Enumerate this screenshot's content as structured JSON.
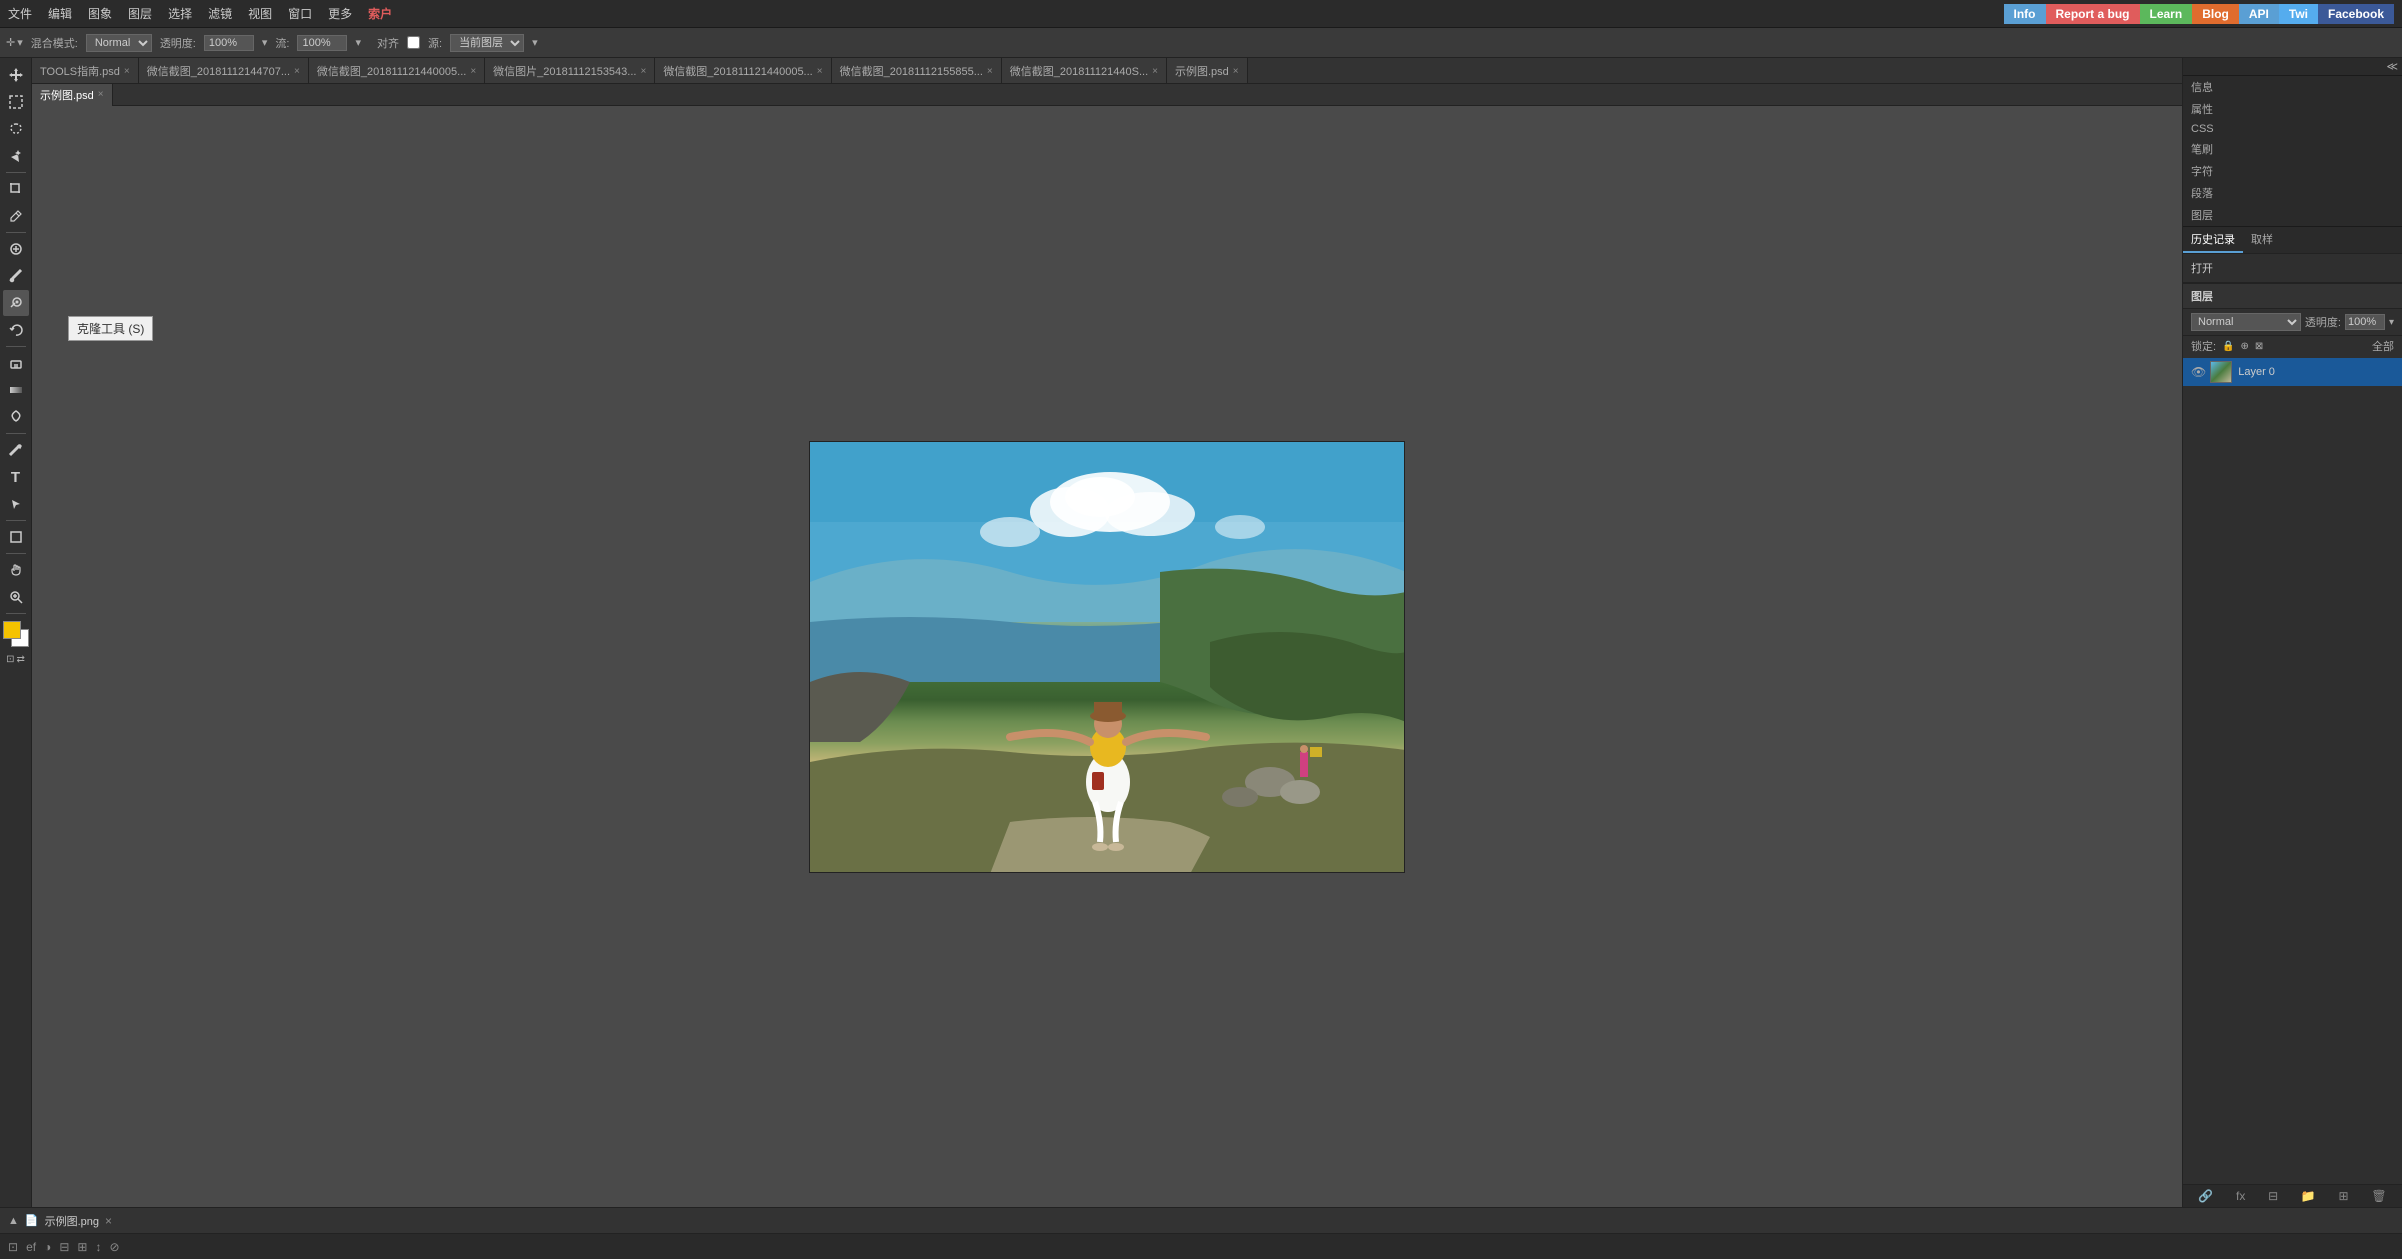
{
  "topnav": {
    "menu_items": [
      "文件",
      "编辑",
      "图象",
      "图层",
      "选择",
      "滤镜",
      "视图",
      "窗口",
      "更多",
      "索户"
    ],
    "badges": [
      {
        "label": "Info",
        "class": "badge-info",
        "name": "info-badge"
      },
      {
        "label": "Report a bug",
        "class": "badge-report",
        "name": "report-badge"
      },
      {
        "label": "Learn",
        "class": "badge-learn",
        "name": "learn-badge"
      },
      {
        "label": "Blog",
        "class": "badge-blog",
        "name": "blog-badge"
      },
      {
        "label": "API",
        "class": "badge-api",
        "name": "api-badge"
      },
      {
        "label": "Twi",
        "class": "badge-twi",
        "name": "twi-badge"
      },
      {
        "label": "Facebook",
        "class": "badge-fb",
        "name": "fb-badge"
      }
    ]
  },
  "optionsbar": {
    "blend_label": "混合模式:",
    "blend_value": "Normal",
    "opacity_label": "透明度:",
    "opacity_value": "100%",
    "flow_label": "流:",
    "flow_value": "100%",
    "align_label": "对齐",
    "source_label": "源:",
    "source_value": "当前图层"
  },
  "tabs": [
    {
      "label": "TOOLS指南.psd",
      "active": false,
      "closable": true
    },
    {
      "label": "微信截图_20181112144707...",
      "active": false,
      "closable": true
    },
    {
      "label": "微信截图_201811121440005...",
      "active": false,
      "closable": true
    },
    {
      "label": "微信图片_20181112153543...",
      "active": false,
      "closable": true
    },
    {
      "label": "微信截图_201811121440005...",
      "active": false,
      "closable": true
    },
    {
      "label": "微信截图_20181112155855...",
      "active": false,
      "closable": true
    },
    {
      "label": "微信截图_201811121440S...",
      "active": false,
      "closable": true
    },
    {
      "label": "示例图.psd",
      "active": false,
      "closable": true
    }
  ],
  "second_tab_row": [
    {
      "label": "示例图.psd",
      "active": true,
      "closable": true
    }
  ],
  "tooltip": {
    "text": "克隆工具 (S)"
  },
  "tools": [
    {
      "name": "move-tool",
      "icon": "↔",
      "tooltip": "移动工具"
    },
    {
      "name": "selection-tool",
      "icon": "⬚",
      "tooltip": "选框工具"
    },
    {
      "name": "lasso-tool",
      "icon": "⌇",
      "tooltip": "套索工具"
    },
    {
      "name": "magic-wand-tool",
      "icon": "✦",
      "tooltip": "魔棒工具"
    },
    {
      "name": "crop-tool",
      "icon": "⊡",
      "tooltip": "裁剪工具"
    },
    {
      "name": "eyedropper-tool",
      "icon": "⌖",
      "tooltip": "吸管工具"
    },
    {
      "name": "spot-heal-tool",
      "icon": "⊕",
      "tooltip": "污点修复画笔"
    },
    {
      "name": "brush-tool",
      "icon": "✏",
      "tooltip": "画笔工具"
    },
    {
      "name": "clone-tool",
      "icon": "◎",
      "tooltip": "克隆工具",
      "active": true
    },
    {
      "name": "history-brush-tool",
      "icon": "↺",
      "tooltip": "历史记录画笔"
    },
    {
      "name": "eraser-tool",
      "icon": "◻",
      "tooltip": "橡皮擦工具"
    },
    {
      "name": "gradient-tool",
      "icon": "▦",
      "tooltip": "渐变工具"
    },
    {
      "name": "burn-tool",
      "icon": "◑",
      "tooltip": "加深工具"
    },
    {
      "name": "pen-tool",
      "icon": "✒",
      "tooltip": "钢笔工具"
    },
    {
      "name": "text-tool",
      "icon": "T",
      "tooltip": "文字工具"
    },
    {
      "name": "path-select-tool",
      "icon": "↗",
      "tooltip": "路径选择工具"
    },
    {
      "name": "shape-tool",
      "icon": "□",
      "tooltip": "形状工具"
    },
    {
      "name": "hand-tool",
      "icon": "✋",
      "tooltip": "手形工具"
    },
    {
      "name": "zoom-tool",
      "icon": "🔍",
      "tooltip": "缩放工具"
    }
  ],
  "colors": {
    "fg": "#f5c300",
    "bg": "#ffffff"
  },
  "rightpanel": {
    "tabs": [
      "历史记录",
      "取样"
    ],
    "side_items": [
      "信息",
      "属性",
      "CSS",
      "笔刷",
      "字符",
      "段落",
      "图层"
    ],
    "history_item": "打开",
    "layers": {
      "title": "图层",
      "blend_mode": "Normal",
      "opacity_label": "透明度:",
      "opacity_value": "100%",
      "lock_label": "锁定:",
      "lock_icons": [
        "🔒",
        "■",
        "⊕",
        "⊠"
      ],
      "fill_label": "全部",
      "items": [
        {
          "name": "Layer 0",
          "visible": true,
          "active": true
        }
      ]
    }
  },
  "statusbar": {
    "icons": [
      "⊡",
      "⊕",
      "◑",
      "⊟",
      "⊞",
      "↕",
      "⊘"
    ]
  },
  "bottomtab": {
    "label": "示例图.png",
    "arrow": "▲"
  },
  "panel_collapse": "≪"
}
